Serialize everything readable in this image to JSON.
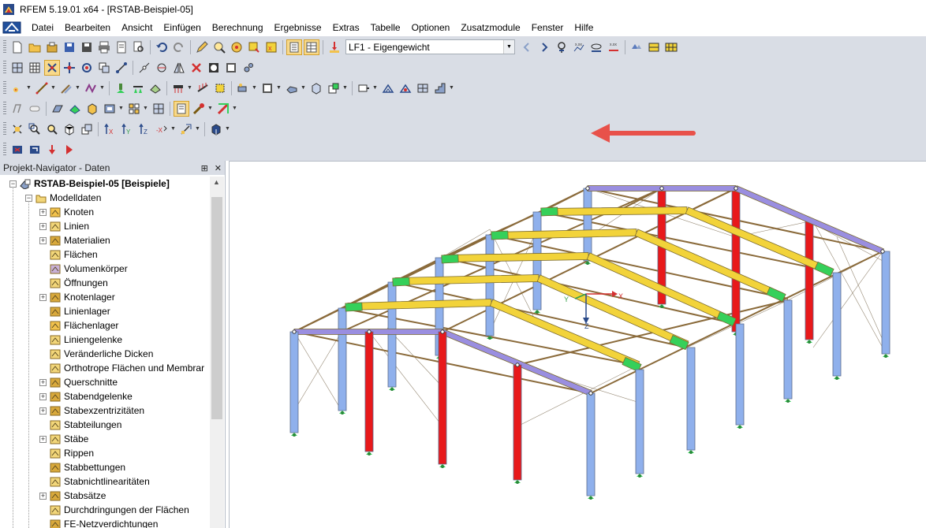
{
  "window": {
    "title": "RFEM 5.19.01 x64 - [RSTAB-Beispiel-05]"
  },
  "menu": {
    "items": [
      "Datei",
      "Bearbeiten",
      "Ansicht",
      "Einfügen",
      "Berechnung",
      "Ergebnisse",
      "Extras",
      "Tabelle",
      "Optionen",
      "Zusatzmodule",
      "Fenster",
      "Hilfe"
    ]
  },
  "toolbar": {
    "load_case": "LF1 - Eigengewicht"
  },
  "navigator": {
    "title": "Projekt-Navigator - Daten",
    "pin_icon": "pin-icon",
    "close_icon": "close-icon",
    "root": "RSTAB-Beispiel-05 [Beispiele]",
    "model_folder": "Modelldaten",
    "items": [
      {
        "label": "Knoten",
        "expandable": true,
        "icon": "node-icon"
      },
      {
        "label": "Linien",
        "expandable": true,
        "icon": "line-icon"
      },
      {
        "label": "Materialien",
        "expandable": true,
        "icon": "material-icon"
      },
      {
        "label": "Flächen",
        "expandable": false,
        "icon": "surface-icon"
      },
      {
        "label": "Volumenkörper",
        "expandable": false,
        "icon": "solid-icon"
      },
      {
        "label": "Öffnungen",
        "expandable": false,
        "icon": "opening-icon"
      },
      {
        "label": "Knotenlager",
        "expandable": true,
        "icon": "nodal-support-icon"
      },
      {
        "label": "Linienlager",
        "expandable": false,
        "icon": "line-support-icon"
      },
      {
        "label": "Flächenlager",
        "expandable": false,
        "icon": "surface-support-icon"
      },
      {
        "label": "Liniengelenke",
        "expandable": false,
        "icon": "line-hinge-icon"
      },
      {
        "label": "Veränderliche Dicken",
        "expandable": false,
        "icon": "variable-thickness-icon"
      },
      {
        "label": "Orthotrope Flächen und Membrar",
        "expandable": false,
        "icon": "orthotropic-icon"
      },
      {
        "label": "Querschnitte",
        "expandable": true,
        "icon": "cross-section-icon"
      },
      {
        "label": "Stabendgelenke",
        "expandable": true,
        "icon": "member-hinge-icon"
      },
      {
        "label": "Stabexzentrizitäten",
        "expandable": true,
        "icon": "eccentricity-icon"
      },
      {
        "label": "Stabteilungen",
        "expandable": false,
        "icon": "member-division-icon"
      },
      {
        "label": "Stäbe",
        "expandable": true,
        "icon": "member-icon"
      },
      {
        "label": "Rippen",
        "expandable": false,
        "icon": "rib-icon"
      },
      {
        "label": "Stabbettungen",
        "expandable": false,
        "icon": "member-foundation-icon"
      },
      {
        "label": "Stabnichtlinearitäten",
        "expandable": false,
        "icon": "member-nonlinearity-icon"
      },
      {
        "label": "Stabsätze",
        "expandable": true,
        "icon": "set-of-members-icon"
      },
      {
        "label": "Durchdringungen der Flächen",
        "expandable": false,
        "icon": "intersection-icon"
      },
      {
        "label": "FE-Netzverdichtungen",
        "expandable": false,
        "icon": "fe-mesh-icon"
      }
    ]
  },
  "viewport": {
    "axis_x": "X",
    "axis_y": "Y",
    "axis_z": "Z"
  },
  "colors": {
    "toolbar_bg": "#d9dde5",
    "column_blue": "#8fb0ec",
    "column_red": "#e8191b",
    "purlin_yellow": "#f2d33a",
    "rafter_purple": "#9a8ee0",
    "brace_brown": "#8a6a3a",
    "hinge_green": "#35d05a",
    "annotation_arrow": "#e8514a"
  }
}
